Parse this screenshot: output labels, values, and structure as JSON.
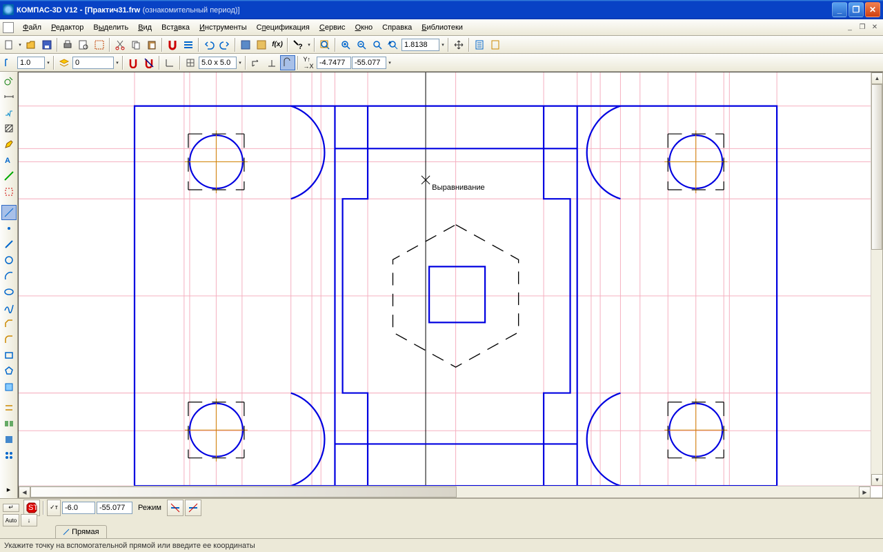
{
  "titlebar": {
    "app": "КОМПАС-3D V12",
    "doc": "[Практич31.frw",
    "suffix": "(ознакомительный период)]"
  },
  "menu": [
    "Файл",
    "Редактор",
    "Выделить",
    "Вид",
    "Вставка",
    "Инструменты",
    "Спецификация",
    "Сервис",
    "Окно",
    "Справка",
    "Библиотеки"
  ],
  "toolbar1": {
    "zoom_value": "1.8138"
  },
  "toolbar2": {
    "line_weight": "1.0",
    "layer": "0",
    "grid": "5.0 x 5.0",
    "coord_x": "-4.7477",
    "coord_y": "-55.077"
  },
  "canvas": {
    "tooltip": "Выравнивание"
  },
  "prop_panel": {
    "x": "-6.0",
    "y": "-55.077",
    "mode_label": "Режим",
    "tab": "Прямая"
  },
  "statusbar": "Укажите точку на вспомогательной прямой или введите ее координаты"
}
